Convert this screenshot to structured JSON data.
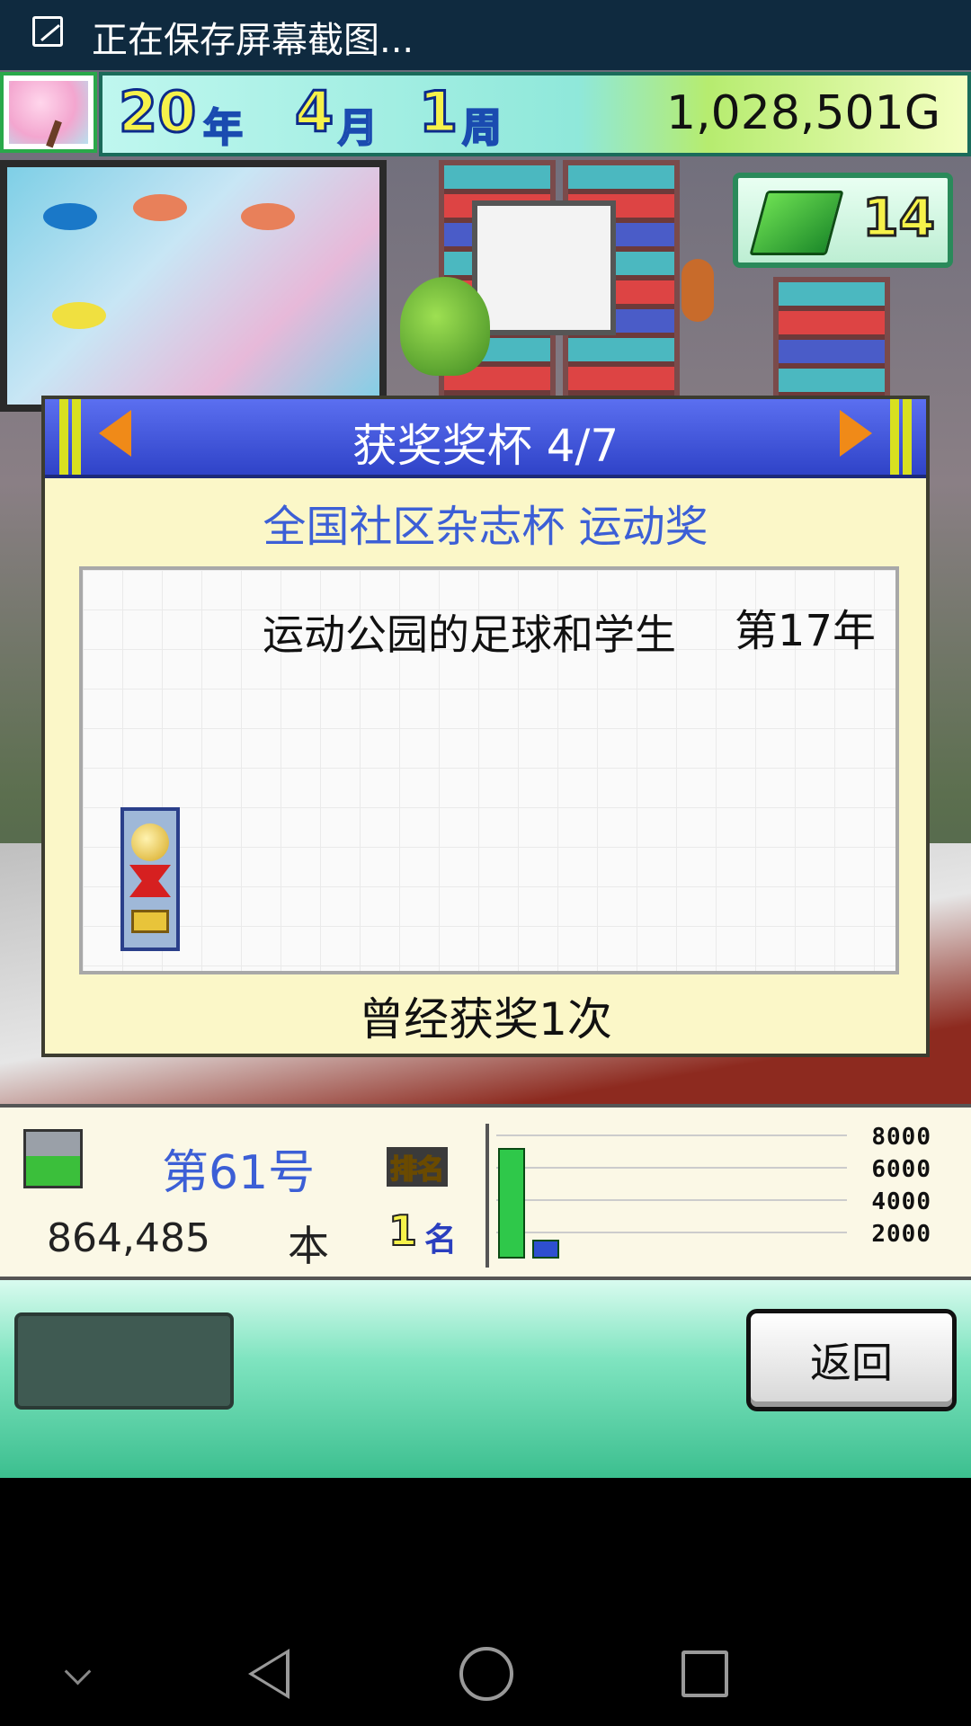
{
  "status_bar": {
    "text": "正在保存屏幕截图..."
  },
  "hud": {
    "year": "20",
    "year_unit": "年",
    "month": "4",
    "month_unit": "月",
    "week": "1",
    "week_unit": "周",
    "money": "1,028,501G",
    "books_count": "14"
  },
  "dialog": {
    "title": "获奖奖杯 4/7",
    "award_name": "全国社区杂志杯 运动奖",
    "magazine_title": "运动公园的足球和学生",
    "award_year": "第17年",
    "award_count_text": "曾经获奖1次"
  },
  "magazine_stats": {
    "issue": "第61号",
    "rank_label": "排名",
    "sales": "864,485",
    "sales_unit": "本",
    "rank_value": "1",
    "rank_unit": "名"
  },
  "chart_data": {
    "type": "bar",
    "categories": [
      "",
      ""
    ],
    "values": [
      3.5,
      0.6
    ],
    "colors": [
      "#2fc84a",
      "#2e4fd0"
    ],
    "tick_labels": [
      "8000",
      "6000",
      "4000",
      "2000"
    ]
  },
  "buttons": {
    "back_label": "返回"
  },
  "icons": {
    "screenshot": "screenshot-icon",
    "nav_down": "chevron-down-icon",
    "nav_back": "back-triangle-icon",
    "nav_home": "home-circle-icon",
    "nav_recent": "recent-square-icon"
  }
}
